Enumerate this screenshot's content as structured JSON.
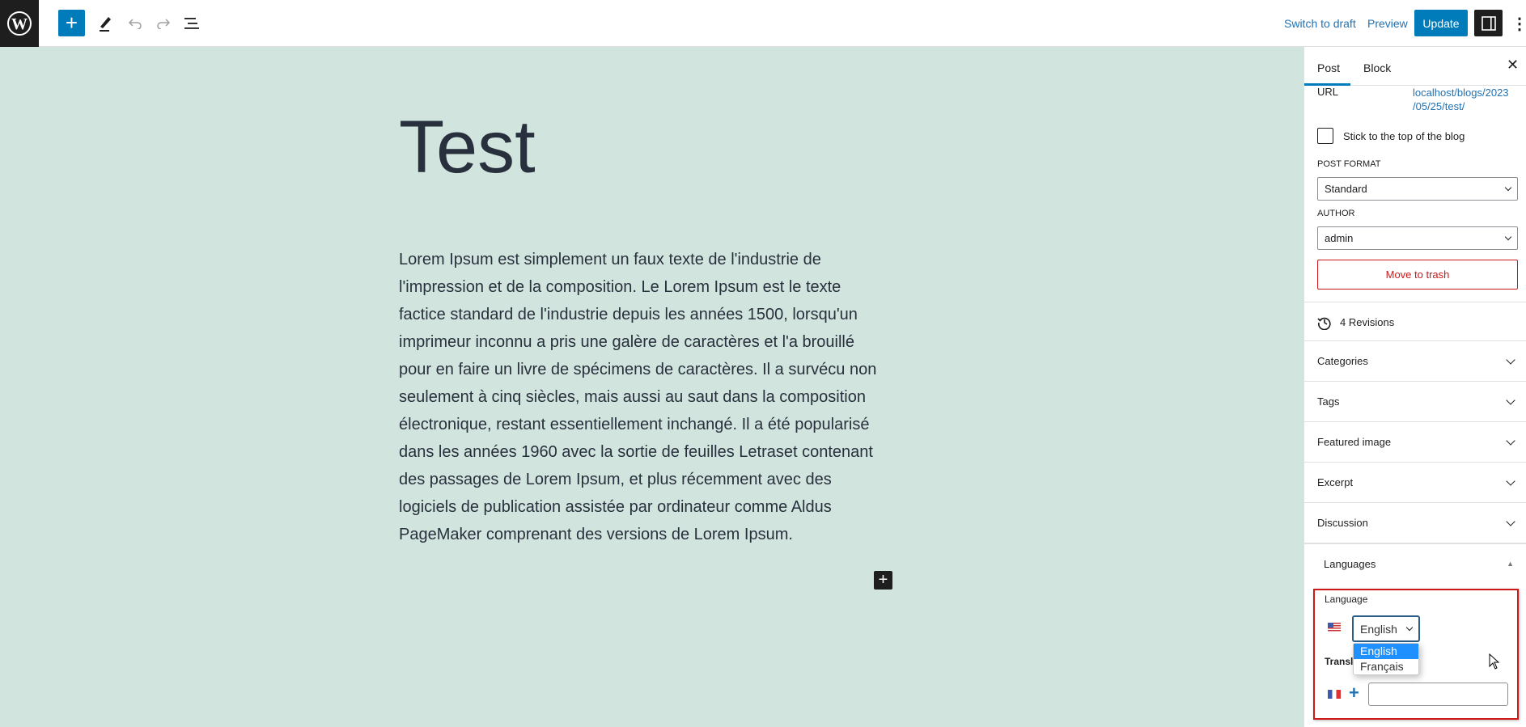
{
  "topbar": {
    "switch_draft": "Switch to draft",
    "preview": "Preview",
    "update": "Update"
  },
  "post": {
    "title": "Test",
    "paragraph_lines": [
      "Lorem Ipsum est simplement un faux texte de l'industrie de",
      "l'impression et de la composition. Le Lorem Ipsum est le texte",
      "factice standard de l'industrie depuis les années 1500, lorsqu'un",
      "imprimeur inconnu a pris une galère de caractères et l'a brouillé",
      "pour en faire un livre de spécimens de caractères. Il a survécu non",
      "seulement à cinq siècles, mais aussi au saut dans la composition",
      "électronique, restant essentiellement inchangé. Il a été popularisé",
      "dans les années 1960 avec la sortie de feuilles Letraset contenant",
      "des passages de Lorem Ipsum, et plus récemment avec des",
      "logiciels de publication assistée par ordinateur comme Aldus",
      "PageMaker comprenant des versions de Lorem Ipsum."
    ]
  },
  "sidebar": {
    "tabs": [
      "Post",
      "Block"
    ],
    "url_label": "URL",
    "url_value_1": "localhost/blogs/2023",
    "url_value_2": "/05/25/test/",
    "sticky": "Stick to the top of the blog",
    "post_format_label": "POST FORMAT",
    "post_format": "Standard",
    "author_label": "AUTHOR",
    "author": "admin",
    "trash": "Move to trash",
    "revisions": "4 Revisions",
    "panels": [
      "Categories",
      "Tags",
      "Featured image",
      "Excerpt",
      "Discussion"
    ],
    "languages": {
      "title": "Languages",
      "language_label": "Language",
      "selected": "English",
      "options": [
        "English",
        "Français"
      ],
      "translations_label": "Translations",
      "translation_value": ""
    }
  },
  "colors": {
    "accent": "#007cba",
    "canvas": "#d2e4de",
    "danger": "#cc1818",
    "highlight_box": "#cc1818"
  }
}
